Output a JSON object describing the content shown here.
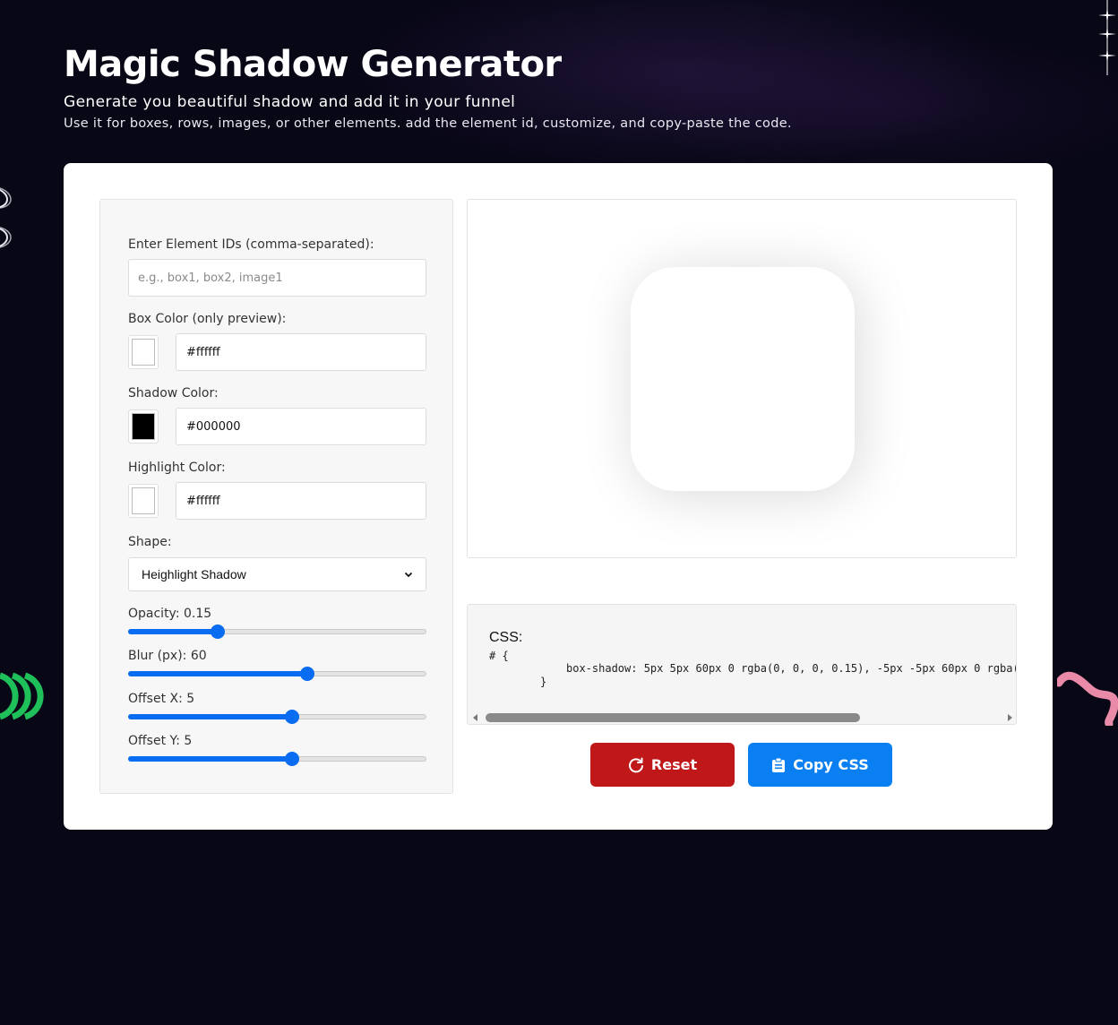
{
  "header": {
    "title": "Magic Shadow Generator",
    "subtitle": "Generate you beautiful shadow and add it in your funnel",
    "description": "Use it for boxes, rows, images, or other elements. add the element id, customize, and copy-paste the code."
  },
  "form": {
    "element_ids": {
      "label": "Enter Element IDs (comma-separated):",
      "value": "",
      "placeholder": "e.g., box1, box2, image1"
    },
    "box_color": {
      "label": "Box Color (only preview):",
      "value": "#ffffff",
      "swatch": "#ffffff"
    },
    "shadow_color": {
      "label": "Shadow Color:",
      "value": "#000000",
      "swatch": "#000000"
    },
    "highlight_color": {
      "label": "Highlight Color:",
      "value": "#ffffff",
      "swatch": "#ffffff"
    },
    "shape": {
      "label": "Shape:",
      "selected": "Heighlight Shadow"
    },
    "opacity": {
      "label": "Opacity: 0.15",
      "value": 0.15,
      "min": 0,
      "max": 0.5
    },
    "blur": {
      "label": "Blur (px): 60",
      "value": 60,
      "min": 0,
      "max": 100
    },
    "offset_x": {
      "label": "Offset X: 5",
      "value": 5,
      "min": -50,
      "max": 50
    },
    "offset_y": {
      "label": "Offset Y: 5",
      "value": 5,
      "min": -50,
      "max": 50
    }
  },
  "output": {
    "css_title": "CSS:",
    "line1": "# {",
    "line2": "box-shadow: 5px 5px 60px 0 rgba(0, 0, 0, 0.15), -5px -5px 60px 0 rgba(",
    "line3": "}"
  },
  "buttons": {
    "reset_label": "Reset",
    "copy_label": "Copy CSS"
  },
  "colors": {
    "accent_blue": "#0a7ff2",
    "slider_blue": "#0a6cf0",
    "reset_red": "#c01818",
    "background": "#080716"
  },
  "icons": {
    "reset": "refresh-icon",
    "copy": "clipboard-icon",
    "select": "chevron-down-icon"
  }
}
